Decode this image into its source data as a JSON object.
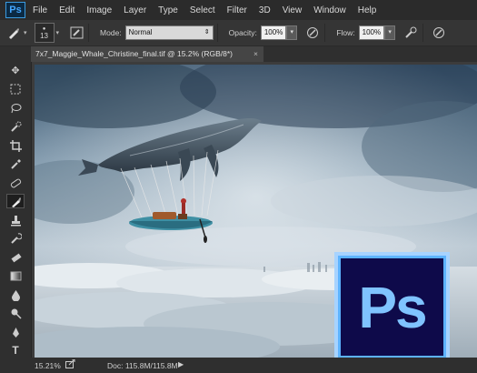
{
  "app": {
    "logo_text": "Ps"
  },
  "menu": [
    "File",
    "Edit",
    "Image",
    "Layer",
    "Type",
    "Select",
    "Filter",
    "3D",
    "View",
    "Window",
    "Help"
  ],
  "options": {
    "brush_size": "13",
    "mode_label": "Mode:",
    "mode_value": "Normal",
    "opacity_label": "Opacity:",
    "opacity_value": "100%",
    "flow_label": "Flow:",
    "flow_value": "100%"
  },
  "document": {
    "tab_title": "7x7_Maggie_Whale_Christine_final.tif @ 15.2% (RGB/8*)",
    "close_glyph": "×"
  },
  "tools": [
    "move-tool",
    "marquee-tool",
    "lasso-tool",
    "quick-select-tool",
    "crop-tool",
    "eyedropper-tool",
    "spot-heal-tool",
    "brush-tool",
    "clone-stamp-tool",
    "history-brush-tool",
    "eraser-tool",
    "gradient-tool",
    "blur-tool",
    "dodge-tool",
    "pen-tool",
    "type-tool"
  ],
  "status": {
    "zoom": "15.21%",
    "doc_info": "Doc: 115.8M/115.8M",
    "more_glyph": "▶"
  },
  "badge": {
    "text": "Ps"
  },
  "colors": {
    "accent": "#45a7ff",
    "badge_bg": "#0e0a4a",
    "sky_top": "#3d5a72",
    "clouds": "#c9d4dc"
  }
}
